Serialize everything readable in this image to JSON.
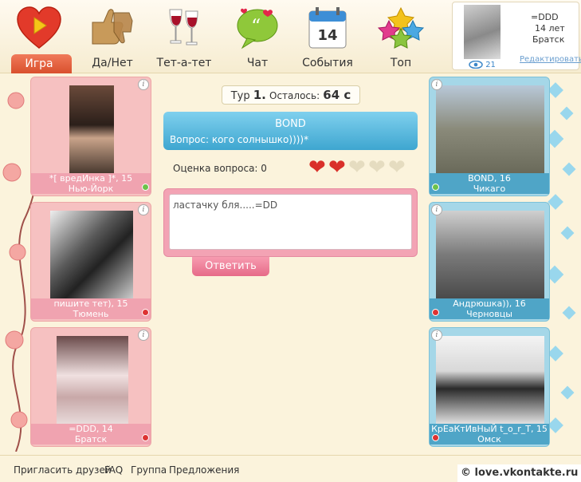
{
  "nav": {
    "items": [
      {
        "label": "Игра",
        "icon": "heart-play-icon"
      },
      {
        "label": "Да/Нет",
        "icon": "thumbs-icon"
      },
      {
        "label": "Тет-а-тет",
        "icon": "wine-glasses-icon"
      },
      {
        "label": "Чат",
        "icon": "chat-bubble-icon"
      },
      {
        "label": "События",
        "icon": "calendar-icon"
      },
      {
        "label": "Топ",
        "icon": "stars-icon"
      }
    ],
    "calendar_day": "14"
  },
  "profile": {
    "name": "=DDD",
    "age": "14 лет",
    "city": "Братск",
    "views": "21",
    "edit_label": "Редактировать"
  },
  "round": {
    "prefix": "Тур",
    "number": "1.",
    "remaining_label": "Осталось:",
    "remaining_value": "64 с"
  },
  "question": {
    "author": "BOND",
    "text": "Вопрос: кого солнышко))))*"
  },
  "rating": {
    "label": "Оценка вопроса: 0",
    "filled": 2,
    "total": 5
  },
  "answer": {
    "text": "ластачку бля.....=DD",
    "reply_label": "Ответить"
  },
  "left_players": [
    {
      "name": "*[ вредИнка ]*, 15",
      "city": "Нью-Йорк",
      "online": true
    },
    {
      "name": "пишите тет), 15",
      "city": "Тюмень",
      "online": false
    },
    {
      "name": "=DDD, 14",
      "city": "Братск",
      "online": false
    }
  ],
  "right_players": [
    {
      "name": "BOND, 16",
      "city": "Чикаго",
      "online": true
    },
    {
      "name": "Андрюшка)), 16",
      "city": "Черновцы",
      "online": false
    },
    {
      "name": "КрЕаКтИвНыЙ t_o_r_T, 15",
      "city": "Омск",
      "online": false
    }
  ],
  "info_glyph": "i",
  "footer": {
    "links": [
      "Пригласить друзей",
      "FAQ",
      "Группа",
      "Предложения"
    ],
    "copyright": "© love.vkontakte.ru"
  },
  "colors": {
    "accent_orange": "#e05a36",
    "question_blue": "#3ea6d0",
    "answer_pink": "#f3a3b4"
  }
}
